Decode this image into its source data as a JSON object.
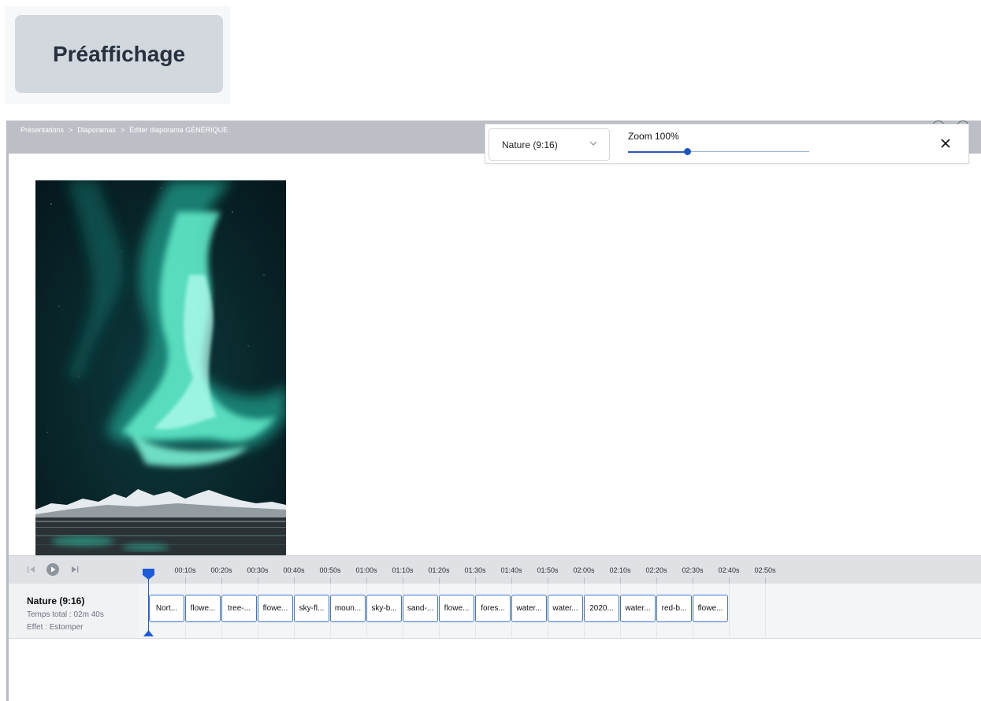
{
  "label_card": {
    "text": "Préaffichage"
  },
  "breadcrumb": [
    "Présentations",
    ">",
    "Diaporamas",
    ">",
    "Éditer diaporama GÉNÉRIQUE"
  ],
  "panel": {
    "select_value": "Nature (9:16)",
    "zoom_label": "Zoom 100%",
    "zoom_level": 0.33
  },
  "timeline": {
    "track": {
      "name": "Nature (9:16)",
      "total": "Temps total : 02m 40s",
      "effect": "Effet : Estomper"
    },
    "ticks": [
      "00:10s",
      "00:20s",
      "00:30s",
      "00:40s",
      "00:50s",
      "01:00s",
      "01:10s",
      "01:20s",
      "01:30s",
      "01:40s",
      "01:50s",
      "02:00s",
      "02:10s",
      "02:20s",
      "02:30s",
      "02:40s",
      "02:50s"
    ],
    "clips": [
      "Nort...",
      "flowe...",
      "tree-...",
      "flowe...",
      "sky-fl...",
      "moun...",
      "sky-b...",
      "sand-...",
      "flowe...",
      "fores...",
      "water...",
      "water...",
      "2020...",
      "water...",
      "red-b...",
      "flowe..."
    ]
  },
  "icons": {
    "chevron": "chevron-down-icon",
    "close": "close-icon",
    "prev": "skip-back-icon",
    "play": "play-icon",
    "next": "skip-forward-icon"
  },
  "colors": {
    "accent": "#1e55c4",
    "clip_border": "#3f75d9",
    "topbar": "#bcc0c6",
    "label_card": "#d2d8de"
  }
}
